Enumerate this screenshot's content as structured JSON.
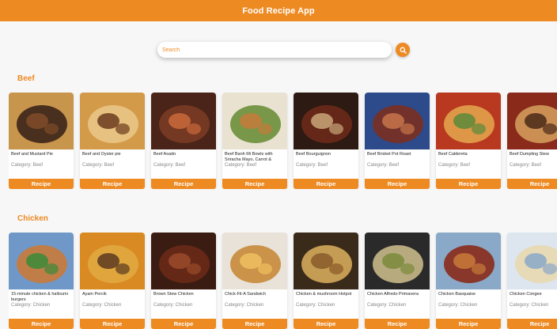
{
  "app": {
    "title": "Food Recipe App",
    "accent": "#ee8a22"
  },
  "search": {
    "placeholder": "Search",
    "icon": "search-icon"
  },
  "sections": [
    {
      "title": "Beef",
      "cards": [
        {
          "name": "Beef and Mustard Pie",
          "category": "Category: Beef",
          "button": "Recipe",
          "img": [
            "#c7954c",
            "#3b2418",
            "#7f4b2a"
          ]
        },
        {
          "name": "Beef and Oyster pie",
          "category": "Category: Beef",
          "button": "Recipe",
          "img": [
            "#d39a4a",
            "#e9c585",
            "#6b3b1e"
          ]
        },
        {
          "name": "Beef Asado",
          "category": "Category: Beef",
          "button": "Recipe",
          "img": [
            "#4a2418",
            "#7a3b24",
            "#c96a3a"
          ]
        },
        {
          "name": "Beef Banh Mi Bowls with Sriracha Mayo, Carrot & Pickled Cucumber",
          "category": "Category: Beef",
          "button": "Recipe",
          "img": [
            "#e9e2d0",
            "#6b8f3a",
            "#c57a3a"
          ]
        },
        {
          "name": "Beef Bourguignon",
          "category": "Category: Beef",
          "button": "Recipe",
          "img": [
            "#2d1a12",
            "#6b2a1a",
            "#c9a67a"
          ]
        },
        {
          "name": "Beef Brisket Pot Roast",
          "category": "Category: Beef",
          "button": "Recipe",
          "img": [
            "#2d4a8a",
            "#7a3020",
            "#c7754a"
          ]
        },
        {
          "name": "Beef Caldereta",
          "category": "Category: Beef",
          "button": "Recipe",
          "img": [
            "#b93820",
            "#e2a24a",
            "#5a8a3a"
          ]
        },
        {
          "name": "Beef Dumpling Stew",
          "category": "Category: Beef",
          "button": "Recipe",
          "img": [
            "#8a2a1a",
            "#d19a5a",
            "#4a2a1a"
          ]
        }
      ]
    },
    {
      "title": "Chicken",
      "cards": [
        {
          "name": "15-minute chicken & halloumi burgers",
          "category": "Category: Chicken",
          "button": "Recipe",
          "img": [
            "#6f98c8",
            "#c97a3a",
            "#3a8a3a"
          ]
        },
        {
          "name": "Ayam Percik",
          "category": "Category: Chicken",
          "button": "Recipe",
          "img": [
            "#d98a22",
            "#e0a840",
            "#5a3a20"
          ]
        },
        {
          "name": "Brown Stew Chicken",
          "category": "Category: Chicken",
          "button": "Recipe",
          "img": [
            "#3a1c12",
            "#6a2a18",
            "#9a4a2a"
          ]
        },
        {
          "name": "Chick-Fil-A Sandwich",
          "category": "Category: Chicken",
          "button": "Recipe",
          "img": [
            "#e8e2d8",
            "#c88a3a",
            "#f0c060"
          ]
        },
        {
          "name": "Chicken & mushroom Hotpot",
          "category": "Category: Chicken",
          "button": "Recipe",
          "img": [
            "#3a2a1a",
            "#d4a85a",
            "#8a5a2a"
          ]
        },
        {
          "name": "Chicken Alfredo Primavera",
          "category": "Category: Chicken",
          "button": "Recipe",
          "img": [
            "#2a2a2a",
            "#c8b888",
            "#7a8a3a"
          ]
        },
        {
          "name": "Chicken Basquaise",
          "category": "Category: Chicken",
          "button": "Recipe",
          "img": [
            "#8aa8c8",
            "#8a2a1a",
            "#c87a3a"
          ]
        },
        {
          "name": "Chicken Congee",
          "category": "Category: Chicken",
          "button": "Recipe",
          "img": [
            "#dde6ee",
            "#e8d8b0",
            "#8aa8c8"
          ]
        }
      ]
    }
  ]
}
